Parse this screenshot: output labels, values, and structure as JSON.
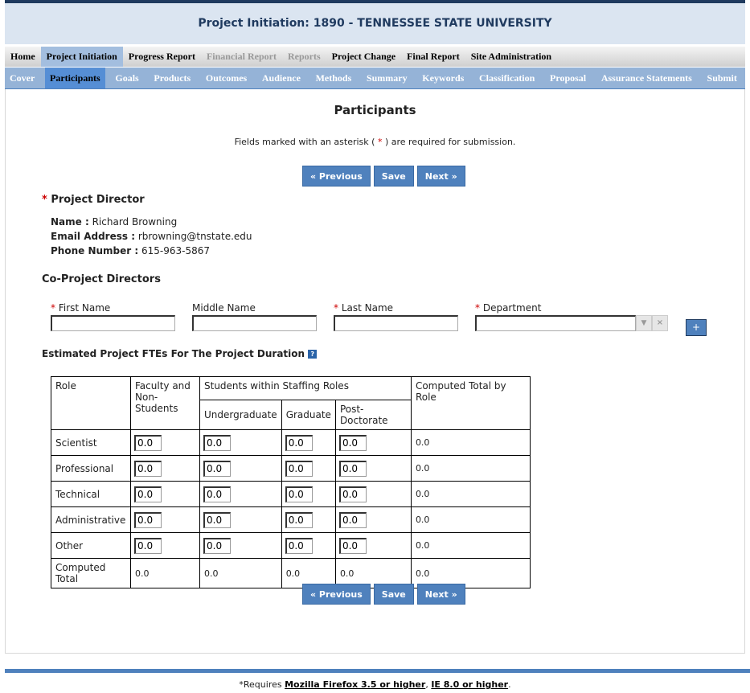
{
  "header": {
    "title": "Project Initiation: 1890 - TENNESSEE STATE UNIVERSITY"
  },
  "mainnav": [
    {
      "label": "Home",
      "state": ""
    },
    {
      "label": "Project Initiation",
      "state": "act"
    },
    {
      "label": "Progress Report",
      "state": ""
    },
    {
      "label": "Financial Report",
      "state": "dis"
    },
    {
      "label": "Reports",
      "state": "dis"
    },
    {
      "label": "Project Change",
      "state": ""
    },
    {
      "label": "Final Report",
      "state": ""
    },
    {
      "label": "Site Administration",
      "state": ""
    }
  ],
  "subnav": [
    {
      "label": "Cover"
    },
    {
      "label": "Participants",
      "active": true
    },
    {
      "label": "Goals"
    },
    {
      "label": "Products"
    },
    {
      "label": "Outcomes"
    },
    {
      "label": "Audience"
    },
    {
      "label": "Methods"
    },
    {
      "label": "Summary"
    },
    {
      "label": "Keywords"
    },
    {
      "label": "Classification"
    },
    {
      "label": "Proposal"
    },
    {
      "label": "Assurance Statements"
    },
    {
      "label": "Submit"
    }
  ],
  "page": {
    "title": "Participants",
    "note_pre": "Fields marked with an asterisk (",
    "asterisk": "*",
    "note_post": ") are required for submission."
  },
  "buttons": {
    "previous": "« Previous",
    "save": "Save",
    "next": "Next »",
    "add": "+"
  },
  "director": {
    "heading": "Project Director",
    "name_label": "Name :",
    "name": "Richard Browning",
    "email_label": "Email Address :",
    "email": "rbrowning@tnstate.edu",
    "phone_label": "Phone Number :",
    "phone": "615-963-5867"
  },
  "co_directors": {
    "heading": "Co-Project Directors",
    "first": "First Name",
    "middle": "Middle Name",
    "last": "Last Name",
    "department": "Department"
  },
  "fte": {
    "heading": "Estimated Project FTEs For The Project Duration",
    "headers": {
      "role": "Role",
      "faculty": "Faculty and Non-Students",
      "students": "Students within Staffing Roles",
      "undergrad": "Undergraduate",
      "graduate": "Graduate",
      "postdoc": "Post-Doctorate",
      "total": "Computed Total by Role"
    },
    "rows": [
      {
        "role": "Scientist",
        "values": [
          "0.0",
          "0.0",
          "0.0",
          "0.0"
        ],
        "total": "0.0"
      },
      {
        "role": "Professional",
        "values": [
          "0.0",
          "0.0",
          "0.0",
          "0.0"
        ],
        "total": "0.0"
      },
      {
        "role": "Technical",
        "values": [
          "0.0",
          "0.0",
          "0.0",
          "0.0"
        ],
        "total": "0.0"
      },
      {
        "role": "Administrative",
        "values": [
          "0.0",
          "0.0",
          "0.0",
          "0.0"
        ],
        "total": "0.0"
      },
      {
        "role": "Other",
        "values": [
          "0.0",
          "0.0",
          "0.0",
          "0.0"
        ],
        "total": "0.0"
      }
    ],
    "computed": {
      "label": "Computed Total",
      "values": [
        "0.0",
        "0.0",
        "0.0",
        "0.0",
        "0.0"
      ]
    }
  },
  "footer": {
    "pre": "*Requires ",
    "firefox": "Mozilla Firefox 3.5 or higher",
    "sep": ", ",
    "ie": "IE 8.0 or higher",
    "end": "."
  }
}
